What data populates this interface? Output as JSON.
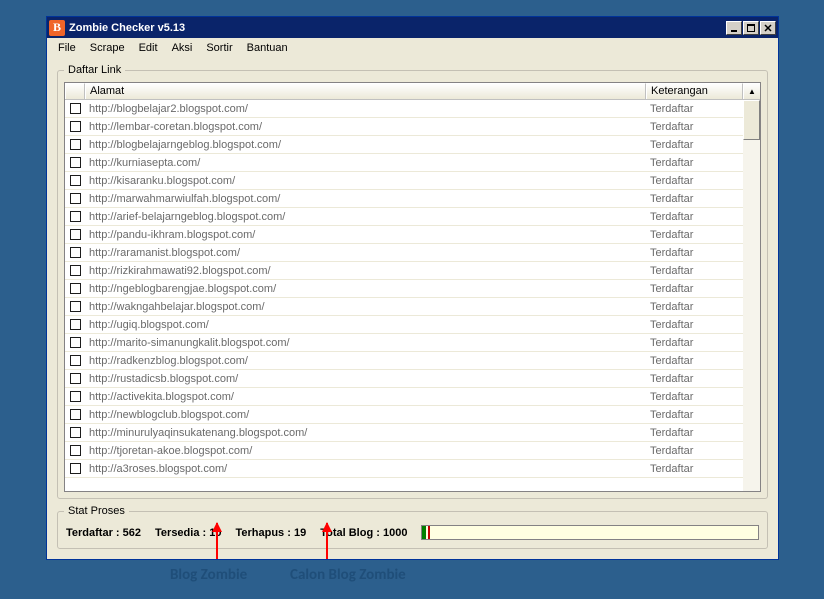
{
  "window": {
    "title": "Zombie Checker v5.13",
    "icon_letter": "B"
  },
  "menu": [
    "File",
    "Scrape",
    "Edit",
    "Aksi",
    "Sortir",
    "Bantuan"
  ],
  "group": {
    "daftar_link": "Daftar Link",
    "stat_proses": "Stat Proses"
  },
  "columns": {
    "alamat": "Alamat",
    "keterangan": "Keterangan"
  },
  "rows": [
    {
      "url": "http://blogbelajar2.blogspot.com/",
      "ket": "Terdaftar"
    },
    {
      "url": "http://lembar-coretan.blogspot.com/",
      "ket": "Terdaftar"
    },
    {
      "url": "http://blogbelajarngeblog.blogspot.com/",
      "ket": "Terdaftar"
    },
    {
      "url": "http://kurniasepta.com/",
      "ket": "Terdaftar"
    },
    {
      "url": "http://kisaranku.blogspot.com/",
      "ket": "Terdaftar"
    },
    {
      "url": "http://marwahmarwiulfah.blogspot.com/",
      "ket": "Terdaftar"
    },
    {
      "url": "http://arief-belajarngeblog.blogspot.com/",
      "ket": "Terdaftar"
    },
    {
      "url": "http://pandu-ikhram.blogspot.com/",
      "ket": "Terdaftar"
    },
    {
      "url": "http://raramanist.blogspot.com/",
      "ket": "Terdaftar"
    },
    {
      "url": "http://rizkirahmawati92.blogspot.com/",
      "ket": "Terdaftar"
    },
    {
      "url": "http://ngeblogbarengjae.blogspot.com/",
      "ket": "Terdaftar"
    },
    {
      "url": "http://wakngahbelajar.blogspot.com/",
      "ket": "Terdaftar"
    },
    {
      "url": "http://ugiq.blogspot.com/",
      "ket": "Terdaftar"
    },
    {
      "url": "http://marito-simanungkalit.blogspot.com/",
      "ket": "Terdaftar"
    },
    {
      "url": "http://radkenzblog.blogspot.com/",
      "ket": "Terdaftar"
    },
    {
      "url": "http://rustadicsb.blogspot.com/",
      "ket": "Terdaftar"
    },
    {
      "url": "http://activekita.blogspot.com/",
      "ket": "Terdaftar"
    },
    {
      "url": "http://newblogclub.blogspot.com/",
      "ket": "Terdaftar"
    },
    {
      "url": "http://minurulyaqinsukatenang.blogspot.com/",
      "ket": "Terdaftar"
    },
    {
      "url": "http://tjoretan-akoe.blogspot.com/",
      "ket": "Terdaftar"
    },
    {
      "url": "http://a3roses.blogspot.com/",
      "ket": "Terdaftar"
    }
  ],
  "stats": {
    "terdaftar_label": "Terdaftar :",
    "terdaftar_value": "562",
    "tersedia_label": "Tersedia :",
    "tersedia_value": "10",
    "terhapus_label": "Terhapus :",
    "terhapus_value": "19",
    "total_label": "Total Blog :",
    "total_value": "1000"
  },
  "scroll_up_glyph": "▲",
  "annotations": {
    "blog_zombie": "Blog Zombie",
    "calon_blog_zombie": "Calon Blog Zombie"
  }
}
